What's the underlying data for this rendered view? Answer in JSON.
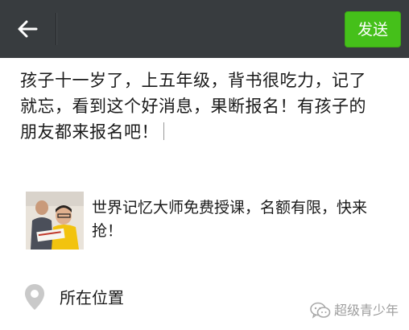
{
  "header": {
    "back_icon": "arrow-left-icon",
    "send_label": "发送",
    "send_color": "#45c01a",
    "bar_color": "#383c3f"
  },
  "composer": {
    "text": "孩子十一岁了，上五年级，背书很吃力，记了\n就忘，看到这个好消息，果断报名！有孩子的\n朋友都来报名吧！"
  },
  "link_card": {
    "thumbnail_icon": "article-thumbnail",
    "title": "世界记忆大师免费授课，名额有限，快来\n抢！"
  },
  "location": {
    "icon": "location-pin-icon",
    "label": "所在位置"
  },
  "watermark": {
    "icon": "wechat-logo-icon",
    "text": "超级青少年"
  }
}
